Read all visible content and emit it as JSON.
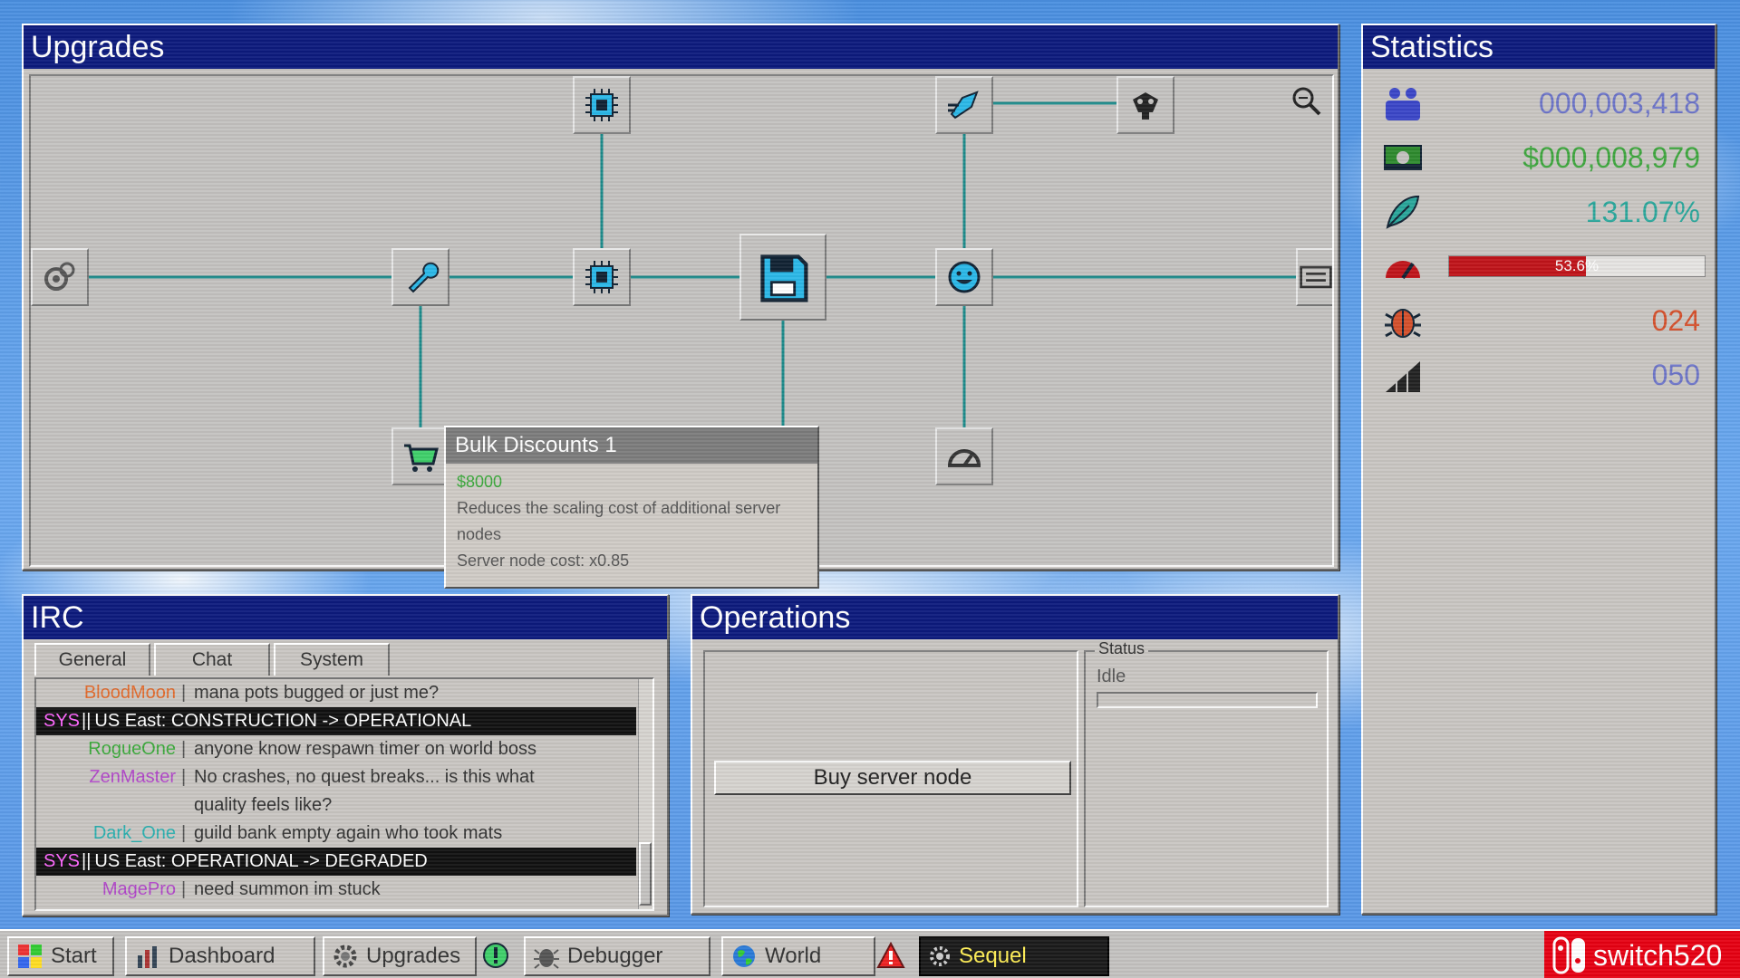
{
  "upgrades": {
    "title": "Upgrades",
    "tooltip": {
      "title": "Bulk Discounts 1",
      "price": "$8000",
      "description": "Reduces the scaling cost of additional server nodes",
      "effect": "Server node cost: x0.85"
    }
  },
  "statistics": {
    "title": "Statistics",
    "players": "000,003,418",
    "money": "$000,008,979",
    "growth": "131.07%",
    "load_text": "53.6%",
    "load_fraction": 0.536,
    "bugs": "024",
    "level": "050",
    "colors": {
      "players": "#6c74c8",
      "money": "#3ea63e",
      "growth": "#2aa79b",
      "load": "#c0141a",
      "bugs": "#d4502c",
      "level": "#6c74c8"
    }
  },
  "irc": {
    "title": "IRC",
    "tabs": [
      "General",
      "Chat",
      "System"
    ],
    "messages": [
      {
        "nick": "BloodMoon",
        "color": "#e26a2c",
        "text": "mana pots bugged or just me?",
        "sys": false
      },
      {
        "nick": "SYS",
        "color": "#ff66ff",
        "text": "US East: CONSTRUCTION -> OPERATIONAL",
        "sys": true
      },
      {
        "nick": "RogueOne",
        "color": "#3aa83a",
        "text": "anyone know respawn timer on world boss",
        "sys": false
      },
      {
        "nick": "ZenMaster",
        "color": "#b046c8",
        "text": "No crashes, no quest breaks... is this what",
        "sys": false
      },
      {
        "nick": "",
        "color": "#333333",
        "text": "quality feels like?",
        "sys": false
      },
      {
        "nick": "Dark_One",
        "color": "#2ab0b0",
        "text": "guild bank empty again who took mats",
        "sys": false
      },
      {
        "nick": "SYS",
        "color": "#ff66ff",
        "text": "US East: OPERATIONAL -> DEGRADED",
        "sys": true
      },
      {
        "nick": "MagePro",
        "color": "#b046c8",
        "text": "need summon im stuck",
        "sys": false
      }
    ]
  },
  "operations": {
    "title": "Operations",
    "buy_label": "Buy server node",
    "status_legend": "Status",
    "status_text": "Idle"
  },
  "taskbar": {
    "start": "Start",
    "dashboard": "Dashboard",
    "upgrades": "Upgrades",
    "debugger": "Debugger",
    "world": "World",
    "sequel": "Sequel",
    "brand": "switch520"
  }
}
